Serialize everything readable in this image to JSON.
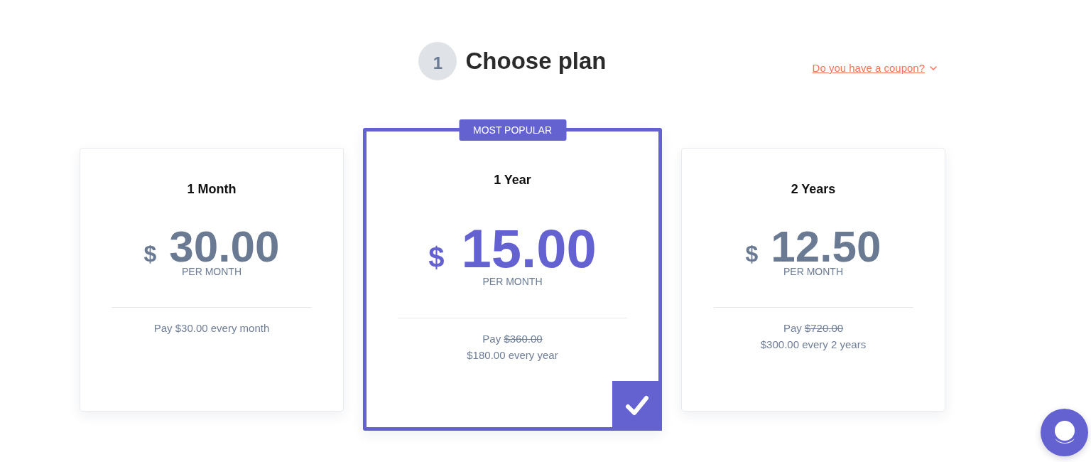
{
  "header": {
    "step": "1",
    "title": "Choose plan"
  },
  "coupon_link": {
    "label": "Do you have a coupon?",
    "expanded": false
  },
  "plans": [
    {
      "name": "1 Month",
      "currency": "$",
      "amount": "30.00",
      "period": "PER MONTH",
      "billing": [
        {
          "text": "Pay $30.00 every month"
        }
      ],
      "selected": false
    },
    {
      "name": "1 Year",
      "badge": "MOST POPULAR",
      "currency": "$",
      "amount": "15.00",
      "period": "PER MONTH",
      "billing": [
        {
          "text": "Pay",
          "old_price": "$360.00"
        },
        {
          "text": "$180.00 every year"
        }
      ],
      "selected": true
    },
    {
      "name": "2 Years",
      "currency": "$",
      "amount": "12.50",
      "period": "PER MONTH",
      "billing": [
        {
          "text": "Pay",
          "old_price": "$720.00"
        },
        {
          "text": "$300.00 every 2 years"
        }
      ],
      "selected": false
    }
  ]
}
